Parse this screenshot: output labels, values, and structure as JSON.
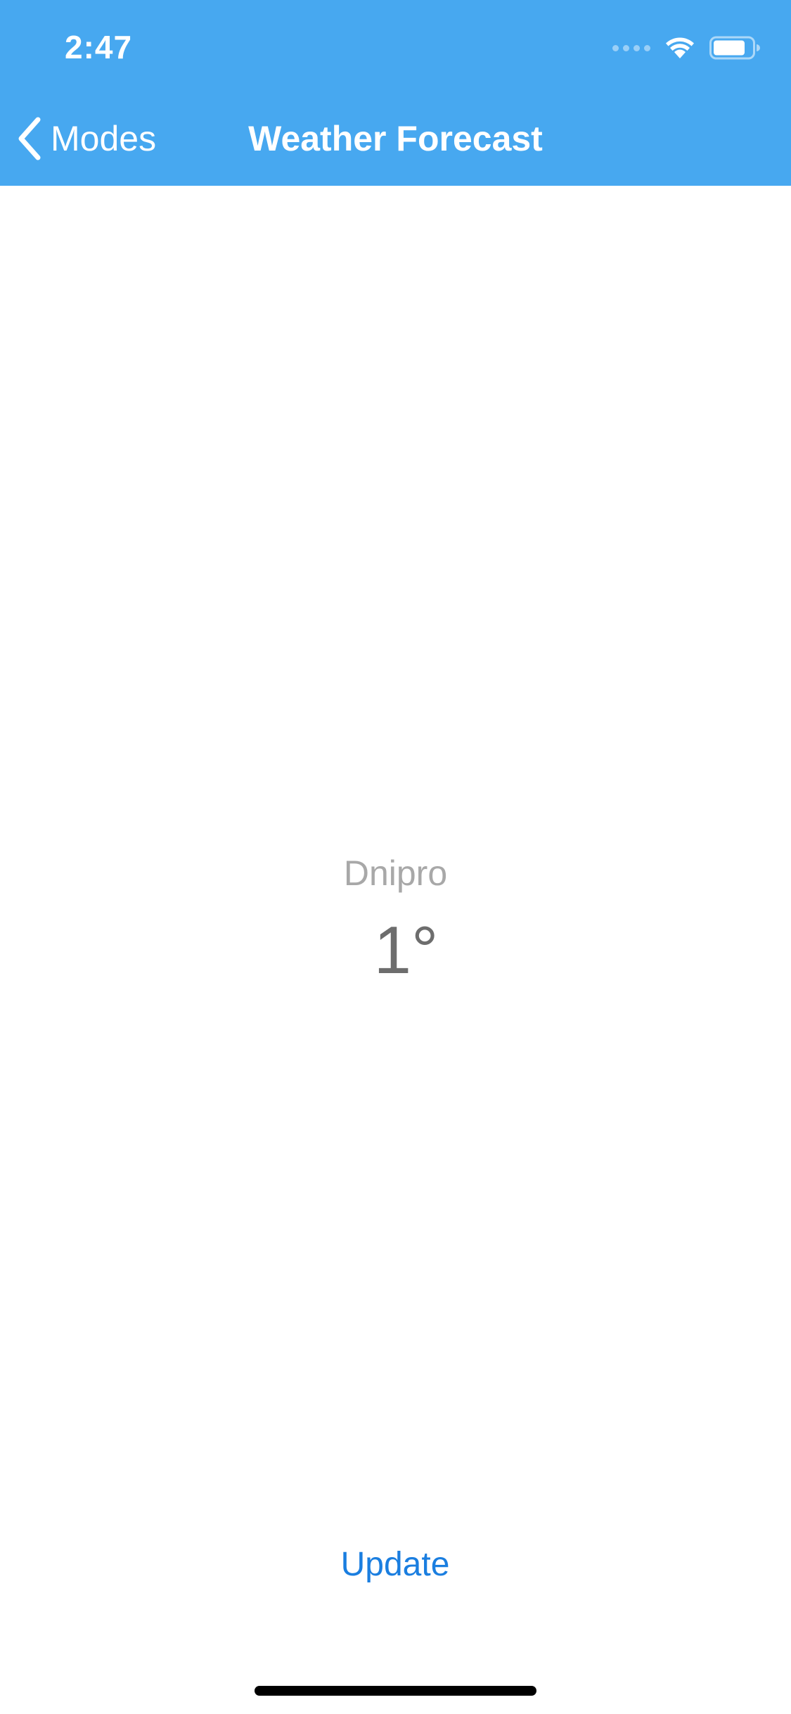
{
  "status_bar": {
    "time": "2:47",
    "icons": [
      "cellular-signal-icon",
      "wifi-icon",
      "battery-icon"
    ]
  },
  "nav_bar": {
    "back_label": "Modes",
    "back_icon": "chevron-left-icon",
    "title": "Weather Forecast"
  },
  "weather": {
    "city": "Dnipro",
    "temperature": "1°"
  },
  "actions": {
    "update_label": "Update"
  },
  "colors": {
    "header_background": "#47a8f0",
    "accent": "#1a7ee0",
    "city_text": "#a8a8a8",
    "temperature_text": "#6d6d6d"
  }
}
